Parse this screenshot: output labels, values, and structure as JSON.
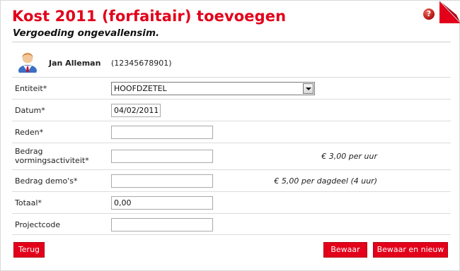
{
  "header": {
    "title": "Kost 2011 (forfaitair) toevoegen",
    "subtitle": "Vergoeding ongevallensim.",
    "help_icon_glyph": "?",
    "accent_color": "#e2001a"
  },
  "user": {
    "name": "Jan Alleman",
    "id": "(12345678901)"
  },
  "form": {
    "entiteit": {
      "label": "Entiteit*",
      "value": "HOOFDZETEL"
    },
    "datum": {
      "label": "Datum*",
      "value": "04/02/2011"
    },
    "reden": {
      "label": "Reden*",
      "value": ""
    },
    "bedrag_vorming": {
      "label_line1": "Bedrag",
      "label_line2": "vormingsactiviteit*",
      "value": "",
      "hint": "€ 3,00 per uur"
    },
    "bedrag_demos": {
      "label": "Bedrag demo's*",
      "value": "",
      "hint": "€ 5,00 per dagdeel (4 uur)"
    },
    "totaal": {
      "label": "Totaal*",
      "value": "0,00"
    },
    "projectcode": {
      "label": "Projectcode",
      "value": ""
    }
  },
  "buttons": {
    "back": "Terug",
    "save": "Bewaar",
    "save_new": "Bewaar en nieuw"
  }
}
